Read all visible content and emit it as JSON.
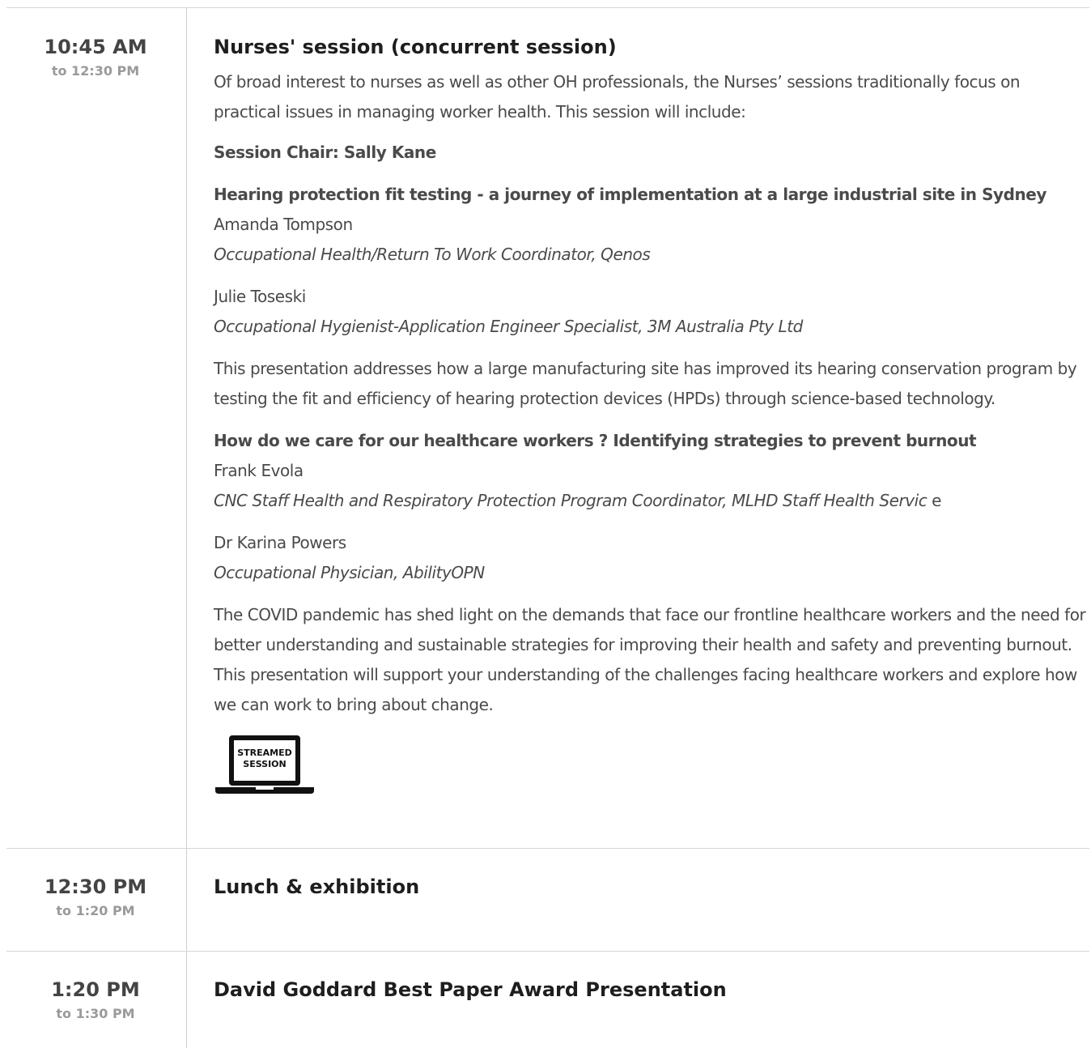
{
  "sessions": [
    {
      "start": "10:45 AM",
      "end": "to 12:30 PM",
      "title": "Nurses' session (concurrent session)",
      "intro": "Of broad interest to nurses as well as other OH professionals, the Nurses’ sessions traditionally focus on practical issues in managing worker health. This session will include:",
      "chair": "Session Chair: Sally Kane",
      "talks": [
        {
          "title": "Hearing protection fit testing - a journey of implementation at a large industrial site in Sydney",
          "speakers": [
            {
              "name": "Amanda Tompson",
              "role": "Occupational Health/Return To Work Coordinator, Qenos"
            },
            {
              "name": "Julie Toseski",
              "role": "Occupational Hygienist-Application Engineer Specialist, 3M Australia Pty Ltd"
            }
          ],
          "abstract": "This presentation addresses how a large manufacturing site has improved its hearing conservation program by testing the fit and efficiency of hearing protection devices (HPDs) through science-based technology."
        },
        {
          "title": "How do we care for our healthcare workers ? Identifying strategies to prevent burnout",
          "speakers": [
            {
              "name": "Frank Evola",
              "role": "CNC Staff Health and Respiratory Protection Program Coordinator, MLHD Staff Health Servic",
              "role_tail": "e"
            },
            {
              "name": "Dr Karina Powers",
              "role": "Occupational Physician, AbilityOPN"
            }
          ],
          "abstract": "The COVID pandemic has shed light on the demands that face our frontline healthcare workers and the need for better understanding and sustainable strategies for improving their health and safety and preventing burnout. This presentation will support your understanding of the challenges facing healthcare workers and explore how we can work to bring about change."
        }
      ],
      "badge": {
        "line1": "STREAMED",
        "line2": "SESSION",
        "icon": "laptop-icon"
      }
    },
    {
      "start": "12:30 PM",
      "end": "to 1:20 PM",
      "title": "Lunch & exhibition"
    },
    {
      "start": "1:20 PM",
      "end": "to 1:30 PM",
      "title": "David Goddard Best Paper Award Presentation"
    }
  ]
}
